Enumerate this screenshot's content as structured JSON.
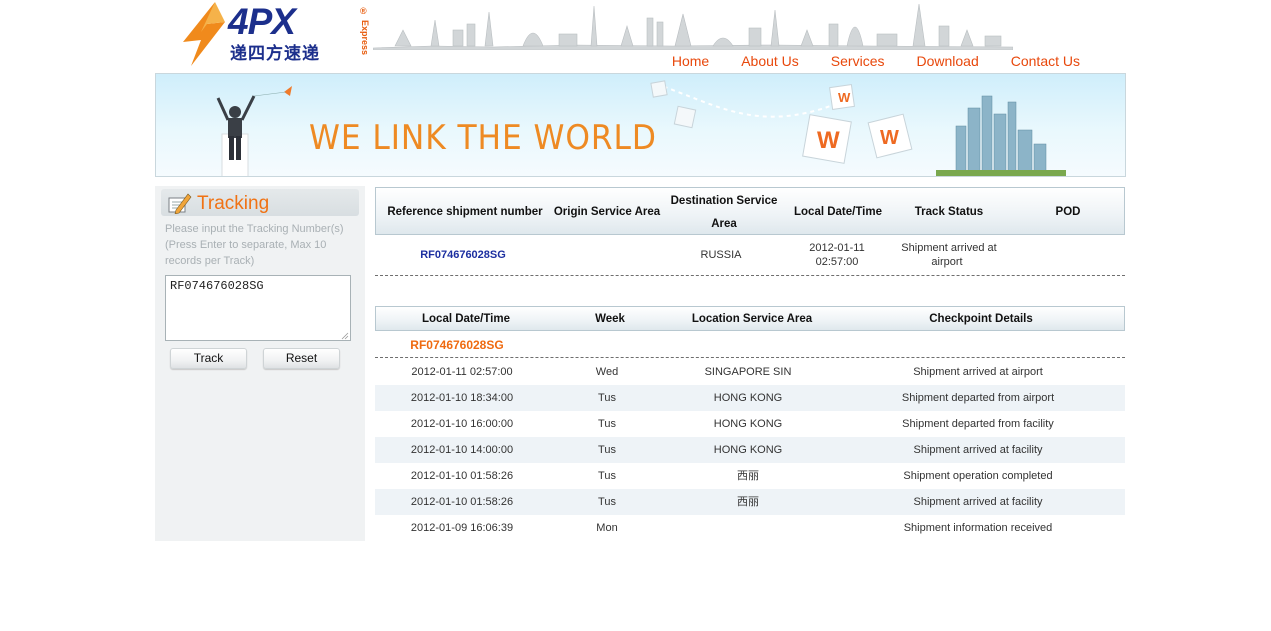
{
  "header": {
    "brand": "4PX",
    "brand_cn": "递四方速递",
    "express": "Express",
    "registered": "®",
    "nav": [
      "Home",
      "About Us",
      "Services",
      "Download",
      "Contact Us"
    ]
  },
  "banner": {
    "slogan": "WE LINK THE WORLD",
    "cube_letter": "W"
  },
  "sidebar": {
    "title": "Tracking",
    "hint": "Please input the Tracking Number(s) (Press Enter to separate, Max 10 records per Track)",
    "input_value": "RF074676028SG",
    "track_label": "Track",
    "reset_label": "Reset"
  },
  "summary": {
    "headers": [
      "Reference shipment number",
      "Origin Service Area",
      "Destination Service Area",
      "Local Date/Time",
      "Track Status",
      "POD"
    ],
    "row": {
      "ref": "RF074676028SG",
      "origin": "",
      "destination": "RUSSIA",
      "date": "2012-01-11",
      "time": "02:57:00",
      "status_line1": "Shipment arrived at",
      "status_line2": "airport",
      "pod": ""
    }
  },
  "details": {
    "headers": [
      "Local Date/Time",
      "Week",
      "Location Service Area",
      "Checkpoint Details"
    ],
    "group_ref": "RF074676028SG",
    "rows": [
      {
        "datetime": "2012-01-11 02:57:00",
        "week": "Wed",
        "location": "SINGAPORE SIN",
        "details": "Shipment arrived at airport"
      },
      {
        "datetime": "2012-01-10 18:34:00",
        "week": "Tus",
        "location": "HONG KONG",
        "details": "Shipment departed from airport"
      },
      {
        "datetime": "2012-01-10 16:00:00",
        "week": "Tus",
        "location": "HONG KONG",
        "details": "Shipment departed from facility"
      },
      {
        "datetime": "2012-01-10 14:00:00",
        "week": "Tus",
        "location": "HONG KONG",
        "details": "Shipment arrived at facility"
      },
      {
        "datetime": "2012-01-10 01:58:26",
        "week": "Tus",
        "location": "西丽",
        "details": "Shipment operation completed"
      },
      {
        "datetime": "2012-01-10 01:58:26",
        "week": "Tus",
        "location": "西丽",
        "details": "Shipment arrived at facility"
      },
      {
        "datetime": "2012-01-09 16:06:39",
        "week": "Mon",
        "location": "",
        "details": "Shipment information received"
      }
    ]
  },
  "colors": {
    "accent": "#e8480c",
    "brand_blue": "#1c2f8c",
    "tracking_orange": "#f07214"
  }
}
